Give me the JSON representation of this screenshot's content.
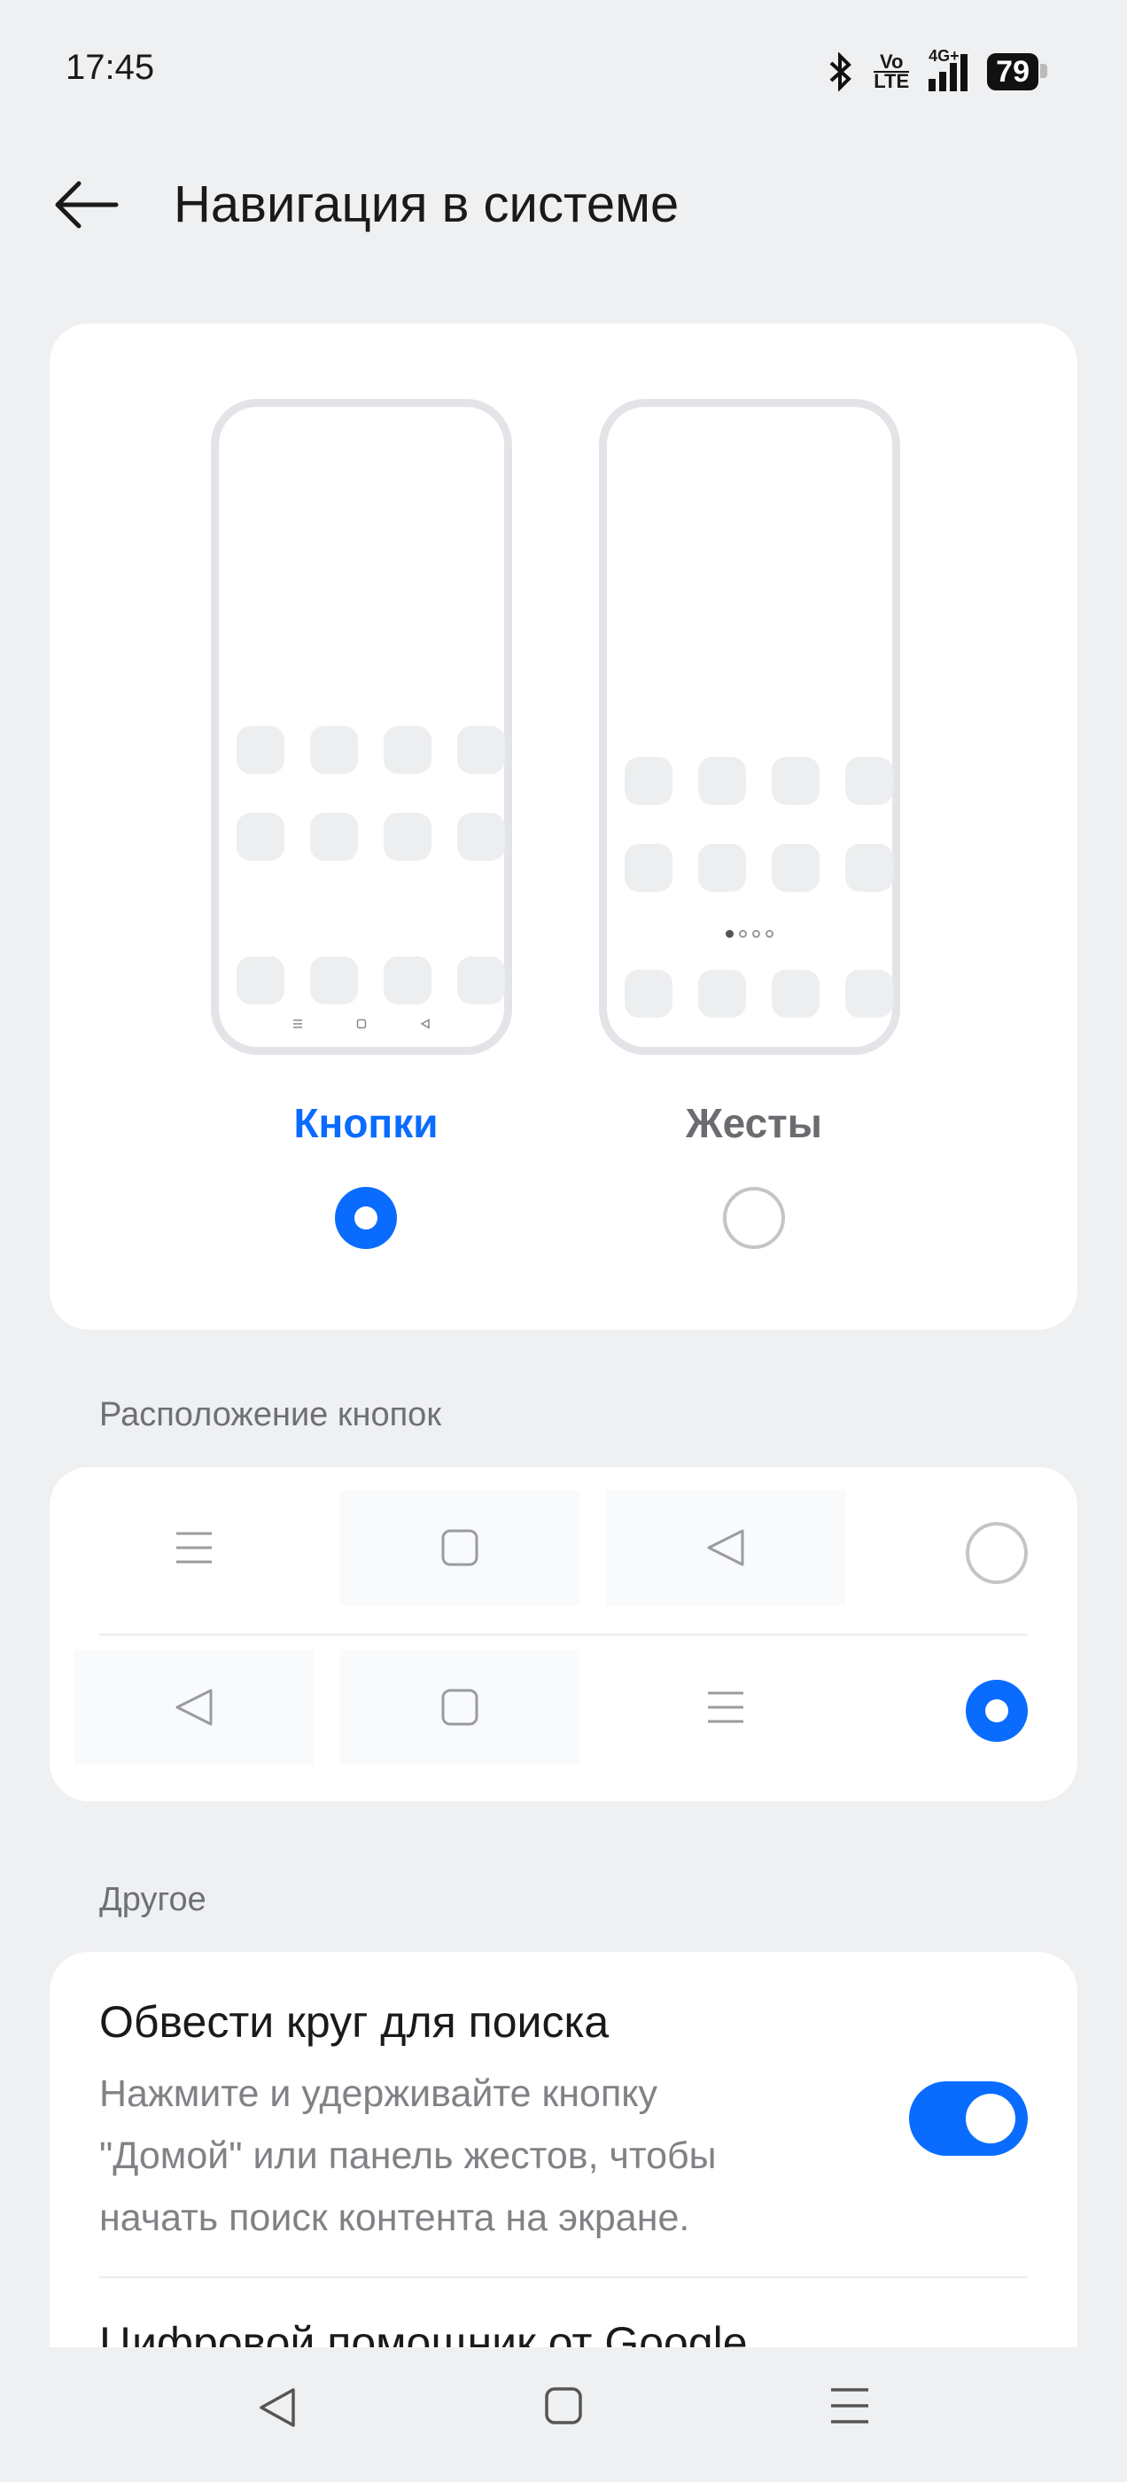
{
  "status_bar": {
    "time": "17:45",
    "battery": "79",
    "volte_top": "Vo",
    "volte_bottom": "LTE",
    "network": "4G+"
  },
  "header": {
    "title": "Навигация в системе"
  },
  "mode_selector": {
    "options": [
      {
        "label": "Кнопки",
        "selected": true
      },
      {
        "label": "Жесты",
        "selected": false
      }
    ],
    "accent_color": "#0a6cff"
  },
  "button_layout": {
    "section_label": "Расположение кнопок",
    "rows": [
      {
        "buttons": [
          "menu-icon",
          "square-icon",
          "back-triangle-icon"
        ],
        "selected": false
      },
      {
        "buttons": [
          "back-triangle-icon",
          "square-icon",
          "menu-icon"
        ],
        "selected": true
      }
    ]
  },
  "other": {
    "section_label": "Другое",
    "items": [
      {
        "title": "Обвести круг для поиска",
        "description_lines": [
          "Нажмите и удерживайте кнопку",
          "\"Домой\" или панель жестов, чтобы",
          "начать поиск контента на экране."
        ],
        "enabled": true
      },
      {
        "title": "Цифровой помощник от Google"
      }
    ]
  },
  "system_nav": {
    "buttons": [
      "back-icon",
      "home-icon",
      "recents-icon"
    ]
  }
}
